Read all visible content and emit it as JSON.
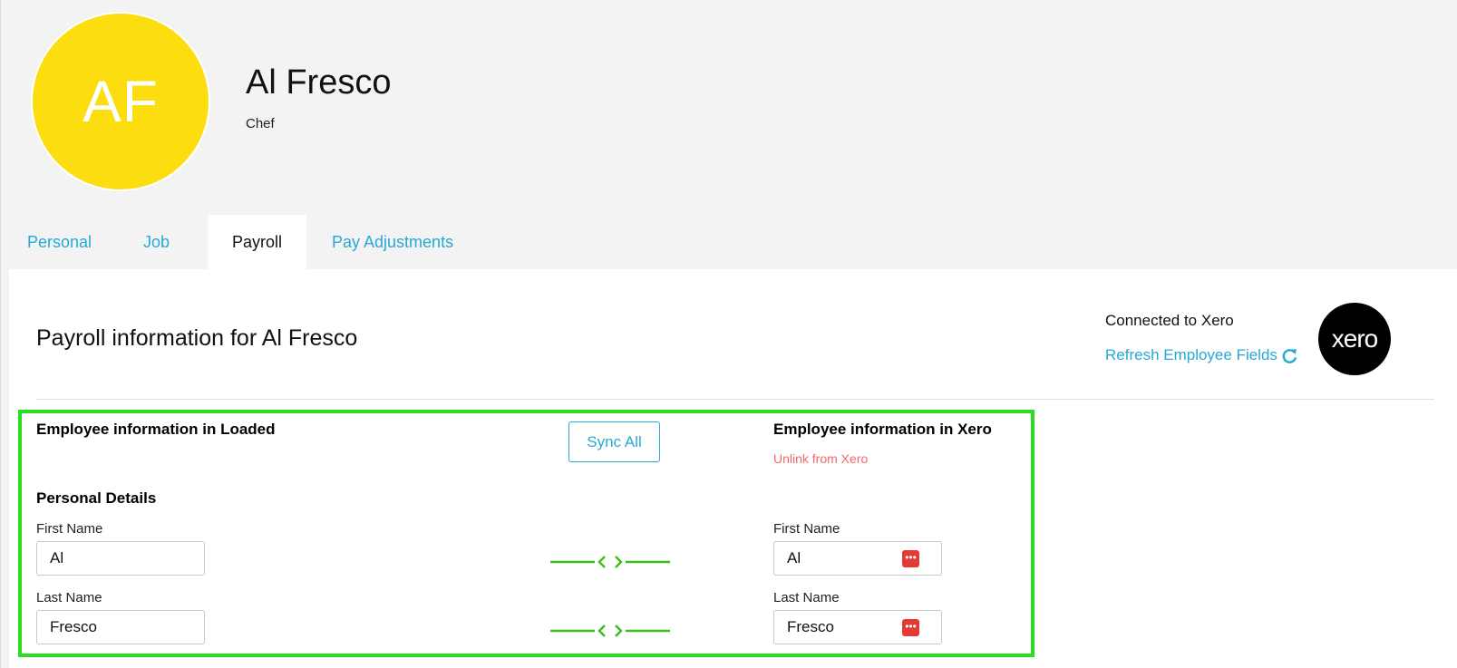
{
  "profile": {
    "initials": "AF",
    "name": "Al Fresco",
    "role": "Chef"
  },
  "tabs": [
    {
      "label": "Personal",
      "active": false
    },
    {
      "label": "Job",
      "active": false
    },
    {
      "label": "Payroll",
      "active": true
    },
    {
      "label": "Pay Adjustments",
      "active": false
    }
  ],
  "payroll": {
    "title": "Payroll information for Al Fresco",
    "connection_status": "Connected to Xero",
    "refresh_label": "Refresh Employee Fields",
    "xero_logo_text": "xero",
    "loaded_heading": "Employee information in Loaded",
    "xero_heading": "Employee information in Xero",
    "unlink_label": "Unlink from Xero",
    "sync_all_label": "Sync All",
    "personal_details_heading": "Personal Details",
    "fields": [
      {
        "label": "First Name",
        "loaded_value": "Al",
        "xero_value": "Al"
      },
      {
        "label": "Last Name",
        "loaded_value": "Fresco",
        "xero_value": "Fresco"
      }
    ]
  },
  "colors": {
    "accent": "#26a9d6",
    "avatar": "#fcde10",
    "highlight": "#28e01f",
    "sync_arrow": "#3cbd1a",
    "unlink": "#f06a6a",
    "xero_badge": "#e53935"
  },
  "icons": {
    "refresh": "refresh-icon",
    "sync": "sync-arrows-icon",
    "xero_field": "ellipsis-badge-icon"
  }
}
